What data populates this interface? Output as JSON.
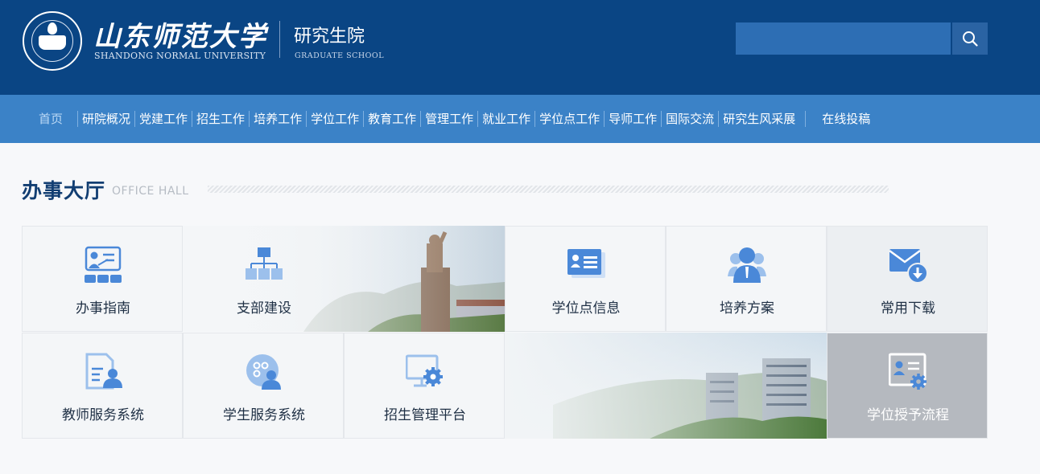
{
  "header": {
    "university_cn": "山东师范大学",
    "university_en": "SHANDONG NORMAL UNIVERSITY",
    "dept_cn": "研究生院",
    "dept_en": "GRADUATE SCHOOL",
    "search_placeholder": ""
  },
  "nav": {
    "home": "首页",
    "items": [
      "研院概况",
      "党建工作",
      "招生工作",
      "培养工作",
      "学位工作",
      "教育工作",
      "管理工作",
      "就业工作",
      "学位点工作",
      "导师工作",
      "国际交流",
      "研究生风采展"
    ],
    "submit": "在线投稿"
  },
  "section": {
    "title": "办事大厅",
    "title_en": "OFFICE HALL"
  },
  "tiles": [
    {
      "label": "办事指南",
      "icon": "teacher-presentation-icon"
    },
    {
      "label": "支部建设",
      "icon": "org-chart-icon"
    },
    {
      "label": "学位点信息",
      "icon": "id-card-icon"
    },
    {
      "label": "培养方案",
      "icon": "users-icon"
    },
    {
      "label": "常用下载",
      "icon": "mail-download-icon"
    },
    {
      "label": "教师服务系统",
      "icon": "teacher-document-icon"
    },
    {
      "label": "学生服务系统",
      "icon": "student-icon"
    },
    {
      "label": "招生管理平台",
      "icon": "monitor-gear-icon"
    },
    {
      "label": "学位授予流程",
      "icon": "certificate-gear-icon"
    }
  ],
  "colors": {
    "header_bg": "#0a4584",
    "nav_bg": "#3b82c7",
    "icon_blue": "#4a88d8",
    "title": "#123e72"
  }
}
